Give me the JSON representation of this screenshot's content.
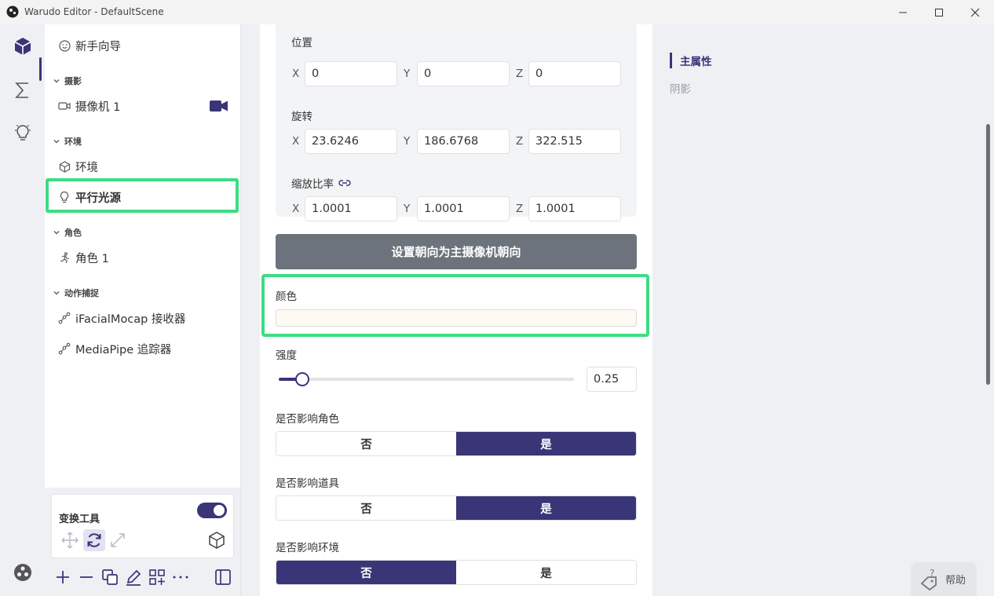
{
  "window": {
    "title": "Warudo Editor - DefaultScene"
  },
  "rail": {
    "items": [
      "cube-icon",
      "sigma-icon",
      "lightbulb-icon"
    ],
    "active_index": 0
  },
  "sidebar": {
    "onboarding_label": "新手向导",
    "sections": {
      "camera": "摄影",
      "environment": "环境",
      "character": "角色",
      "mocap": "动作捕捉"
    },
    "items": {
      "camera_1": "摄像机 1",
      "environment": "环境",
      "directional_light": "平行光源",
      "character_1": "角色 1",
      "ifacial": "iFacialMocap 接收器",
      "mediapipe": "MediaPipe 追踪器"
    },
    "selected": "平行光源"
  },
  "tools": {
    "title": "变换工具",
    "toggle_on": true
  },
  "main": {
    "position": {
      "label": "位置",
      "x": "0",
      "y": "0",
      "z": "0"
    },
    "rotation": {
      "label": "旋转",
      "x": "23.6246",
      "y": "186.6768",
      "z": "322.515"
    },
    "scale": {
      "label": "缩放比率",
      "x": "1.0001",
      "y": "1.0001",
      "z": "1.0001"
    },
    "axis_labels": {
      "x": "X",
      "y": "Y",
      "z": "Z"
    },
    "face_camera_button": "设置朝向为主摄像机朝向",
    "color_label": "颜色",
    "color_value": "#fcfaf2",
    "intensity_label": "强度",
    "intensity_value": "0.25",
    "intensity_fraction": 0.08,
    "affect_character": {
      "label": "是否影响角色",
      "no": "否",
      "yes": "是",
      "selected": "yes"
    },
    "affect_props": {
      "label": "是否影响道具",
      "no": "否",
      "yes": "是",
      "selected": "yes"
    },
    "affect_environment": {
      "label": "是否影响环境",
      "no": "否",
      "yes": "是",
      "selected": "no"
    }
  },
  "outline": {
    "items": [
      "主属性",
      "阴影"
    ],
    "active": "主属性"
  },
  "help": {
    "label": "帮助"
  },
  "colors": {
    "accent": "#3a3577",
    "highlight": "#3ddc84",
    "button_gray": "#6c737c"
  }
}
